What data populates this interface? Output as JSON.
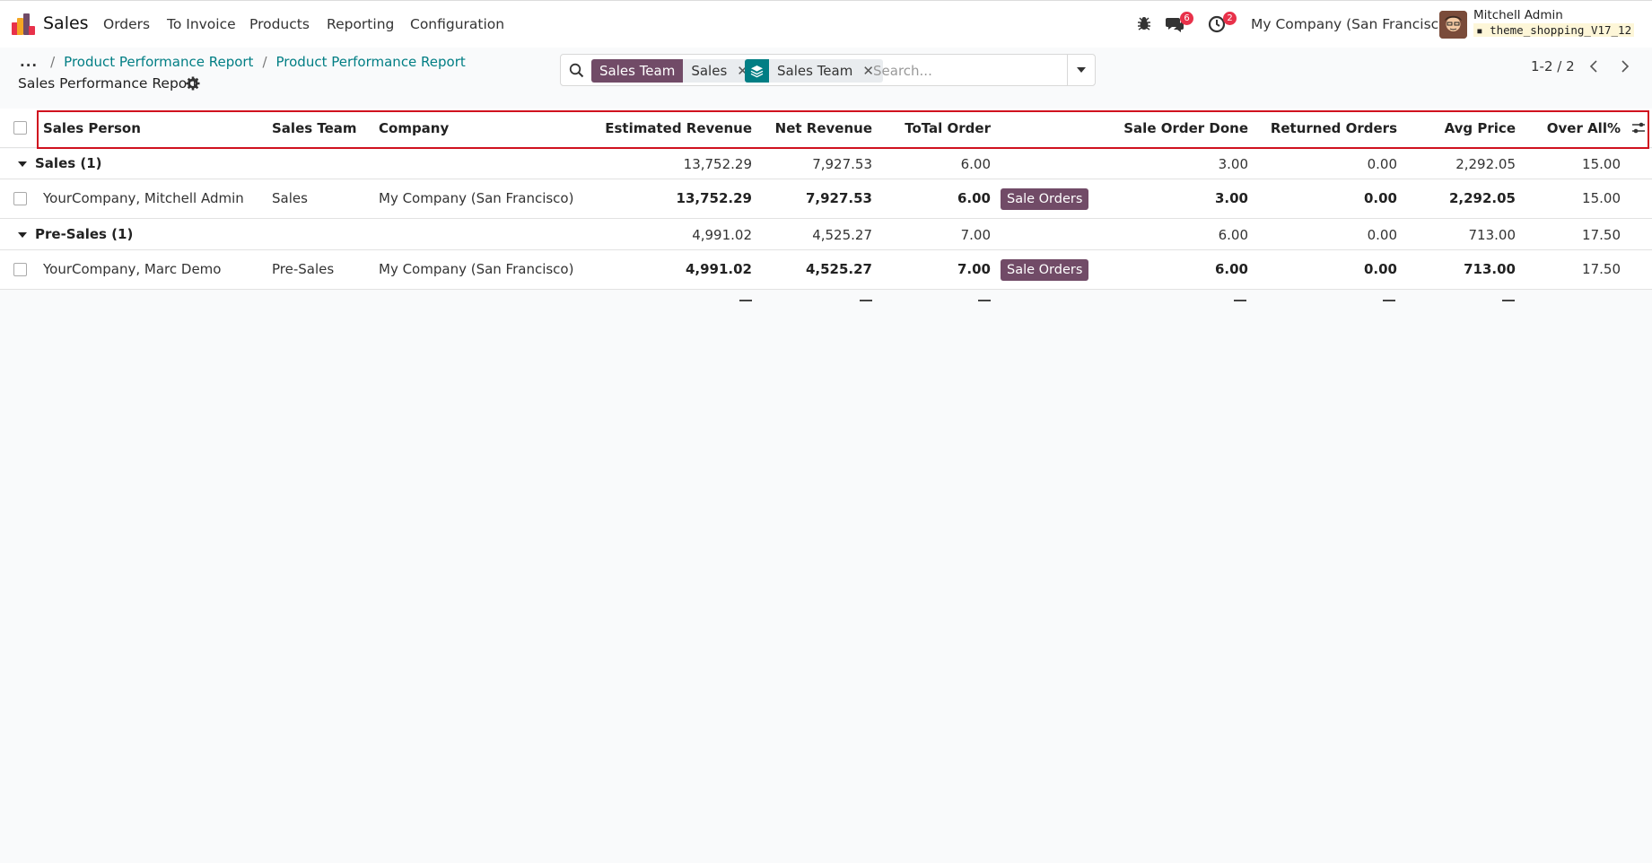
{
  "nav": {
    "app_name": "Sales",
    "menu": [
      "Orders",
      "To Invoice",
      "Products",
      "Reporting",
      "Configuration"
    ],
    "messages_badge": "6",
    "activities_badge": "2",
    "company": "My Company (San Francisco)",
    "user_name": "Mitchell Admin",
    "db_name": "theme_shopping_V17_12"
  },
  "breadcrumb": {
    "dots": "...",
    "sep": "/",
    "items": [
      "Product Performance Report",
      "Product Performance Report"
    ],
    "current": "Sales Performance Report"
  },
  "search": {
    "facets": [
      {
        "label": "Sales Team",
        "value": "Sales"
      },
      {
        "label": "",
        "icon": "layers-icon",
        "value": "Sales Team"
      }
    ],
    "placeholder": "Search..."
  },
  "pager": {
    "text": "1-2 / 2"
  },
  "table": {
    "columns": [
      "Sales Person",
      "Sales Team",
      "Company",
      "Estimated Revenue",
      "Net Revenue",
      "ToTal Order",
      "Sale Order Done",
      "Returned Orders",
      "Avg Price",
      "Over All%"
    ],
    "groups": [
      {
        "label": "Sales (1)",
        "totals": {
          "est": "13,752.29",
          "net": "7,927.53",
          "total": "6.00",
          "done": "3.00",
          "returned": "0.00",
          "avg": "2,292.05",
          "overall": "15.00"
        },
        "row": {
          "person": "YourCompany, Mitchell Admin",
          "team": "Sales",
          "company": "My Company (San Francisco)",
          "est": "13,752.29",
          "net": "7,927.53",
          "total": "6.00",
          "button": "Sale Orders",
          "done": "3.00",
          "returned": "0.00",
          "avg": "2,292.05",
          "overall": "15.00"
        }
      },
      {
        "label": "Pre-Sales (1)",
        "totals": {
          "est": "4,991.02",
          "net": "4,525.27",
          "total": "7.00",
          "done": "6.00",
          "returned": "0.00",
          "avg": "713.00",
          "overall": "17.50"
        },
        "row": {
          "person": "YourCompany, Marc Demo",
          "team": "Pre-Sales",
          "company": "My Company (San Francisco)",
          "est": "4,991.02",
          "net": "4,525.27",
          "total": "7.00",
          "button": "Sale Orders",
          "done": "6.00",
          "returned": "0.00",
          "avg": "713.00",
          "overall": "17.50"
        }
      }
    ]
  },
  "colors": {
    "primary": "#714b67",
    "link": "#017e84",
    "highlight": "#d0121f",
    "badge": "#e8314a"
  }
}
